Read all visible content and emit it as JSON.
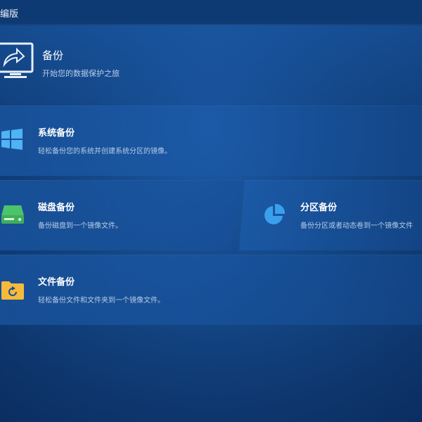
{
  "window": {
    "title": "编版"
  },
  "header": {
    "title": "备份",
    "subtitle": "开始您的数据保护之旅",
    "icon": "monitor-backup-icon"
  },
  "cards": {
    "system": {
      "title": "系统备份",
      "desc": "轻松备份您的系统并创建系统分区的镜像。",
      "icon": "windows-logo-icon"
    },
    "disk": {
      "title": "磁盘备份",
      "desc": "备份磁盘到一个镜像文件。",
      "icon": "disk-drive-icon"
    },
    "partition": {
      "title": "分区备份",
      "desc": "备份分区或者动态卷到一个镜像文件",
      "icon": "pie-chart-icon"
    },
    "file": {
      "title": "文件备份",
      "desc": "轻松备份文件和文件夹到一个镜像文件。",
      "icon": "folder-refresh-icon"
    }
  },
  "colors": {
    "disk_icon": "#4cc46a",
    "partition_icon": "#3aa0ee",
    "folder_icon": "#f5b93b",
    "windows_icon": "#4fb3f5"
  }
}
